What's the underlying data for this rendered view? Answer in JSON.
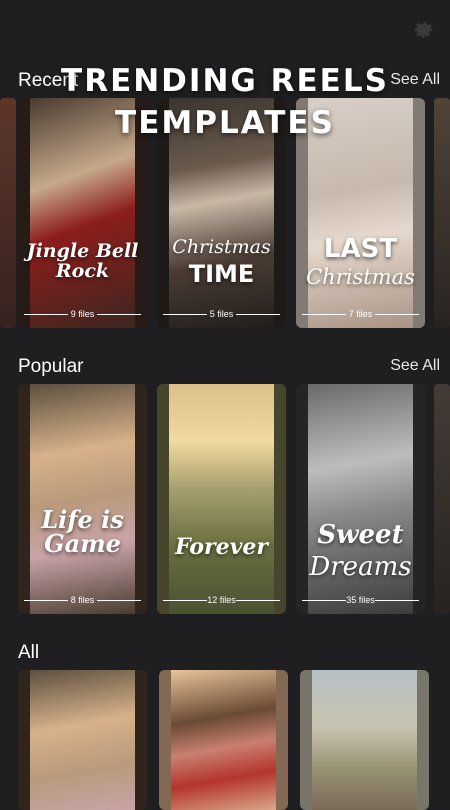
{
  "header": {
    "banner_line1": "TRENDING REELS",
    "banner_line2": "TEMPLATES"
  },
  "settings_icon": "gear-icon",
  "sections": {
    "recent": {
      "title": "Recent",
      "see_all": "See All"
    },
    "popular": {
      "title": "Popular",
      "see_all": "See All"
    },
    "all": {
      "title": "All"
    }
  },
  "recent_cards": [
    {
      "label": "Jingle Bell Rock",
      "files": "9 files"
    },
    {
      "label_script": "Christmas",
      "label_bold": "TIME",
      "files": "5 files"
    },
    {
      "label_bold": "LAST",
      "label_script": "Christmas",
      "files": "7 files"
    }
  ],
  "popular_cards": [
    {
      "label": "Life is Game",
      "files": "8 files"
    },
    {
      "label": "Forever",
      "files": "12 files"
    },
    {
      "label_bold": "Sweet",
      "label_script": "Dreams",
      "files": "35 files"
    }
  ]
}
